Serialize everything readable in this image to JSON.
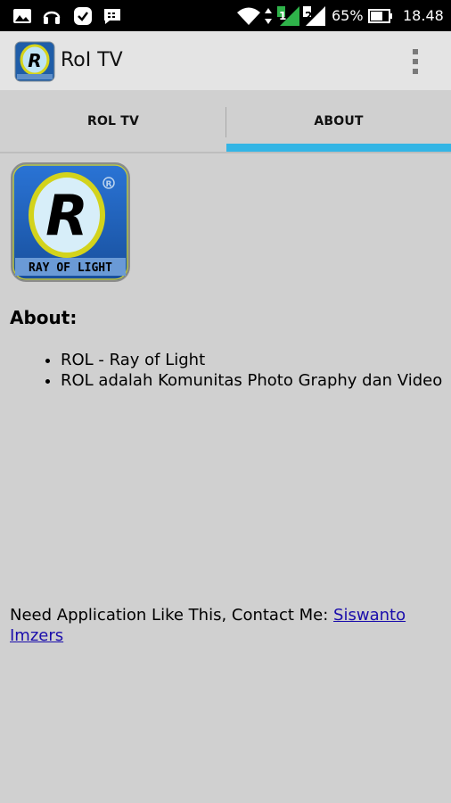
{
  "status_bar": {
    "battery_percent": "65%",
    "time": "18.48",
    "sim1_label": "1",
    "sim2_label": "2",
    "icons": [
      "image-icon",
      "headset-icon",
      "check-badge-icon",
      "chat-icon",
      "wifi-icon",
      "signal-icon",
      "battery-icon"
    ]
  },
  "app_bar": {
    "title": "RoI TV",
    "icon": "rol-logo-icon",
    "menu_icon": "overflow-menu-icon"
  },
  "tabs": [
    {
      "label": "ROL TV",
      "selected": false
    },
    {
      "label": "ABOUT",
      "selected": true
    }
  ],
  "logo": {
    "text": "RAY OF LIGHT",
    "letter": "R",
    "registered": "R"
  },
  "about": {
    "heading": "About:",
    "items": [
      "ROL - Ray of Light",
      "ROL adalah Komunitas Photo Graphy dan Video"
    ]
  },
  "contact": {
    "text": "Need Application Like This, Contact Me: ",
    "link_text": "Siswanto Imzers"
  },
  "colors": {
    "tab_indicator": "#33b5e5",
    "link": "#1a0dab",
    "background": "#d0d0d0",
    "logo_blue": "#1d6fd0",
    "logo_ring": "#d6d41a"
  }
}
